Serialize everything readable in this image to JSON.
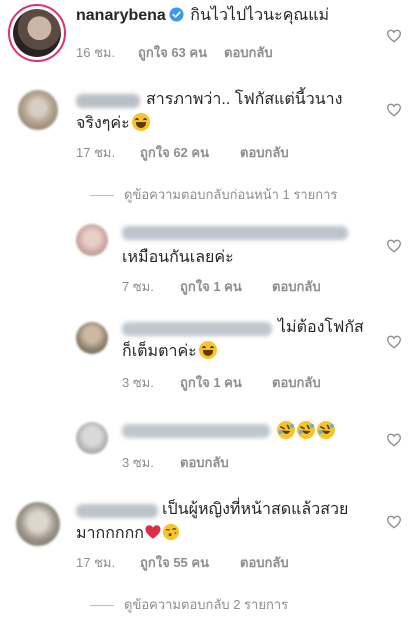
{
  "comments": [
    {
      "author": "nanarybena",
      "text": "กินไวไปไวนะคุณแม่",
      "time": "16 ชม.",
      "likes": "ถูกใจ 63 คน",
      "reply": "ตอบกลับ"
    },
    {
      "text_line1": "สารภาพว่า.. โฟกัสแต่นี้วนาง",
      "text_line2": "จริงๆค่ะ",
      "time": "17 ชม.",
      "likes": "ถูกใจ 62 คน",
      "reply": "ตอบกลับ",
      "view_replies": "ดูข้อความตอบกลับก่อนหน้า 1 รายการ"
    },
    {
      "text": "เหมือนกันเลยค่ะ",
      "time": "7 ซม.",
      "likes": "ถูกใจ 1 คน",
      "reply": "ตอบกลับ"
    },
    {
      "text_line1": "ไม่ต้องโฟกัส",
      "text_line2": "ก็เต็มตาค่ะ",
      "time": "3 ซม.",
      "likes": "ถูกใจ 1 คน",
      "reply": "ตอบกลับ"
    },
    {
      "time": "3 ซม.",
      "reply": "ตอบกลับ"
    },
    {
      "text_line1": "เป็นผู้หญิงที่หน้าสดแล้วสวย",
      "text_line2": "มากกกกก",
      "time": "17 ชม.",
      "likes": "ถูกใจ 55 คน",
      "reply": "ตอบกลับ",
      "view_replies": "ดูข้อความตอบกลับ 2 รายการ"
    }
  ],
  "icons": {
    "verified": "verified-badge-icon",
    "like": "heart-outline-icon",
    "grin": "grinning-squinting-face-emoji",
    "laugh_cry": "rolling-laughing-face-emoji",
    "red_heart": "red-heart-emoji",
    "kiss": "face-blowing-kiss-emoji"
  },
  "colors": {
    "text": "#262626",
    "meta": "#8e8e8e",
    "verified": "#3897f0"
  }
}
